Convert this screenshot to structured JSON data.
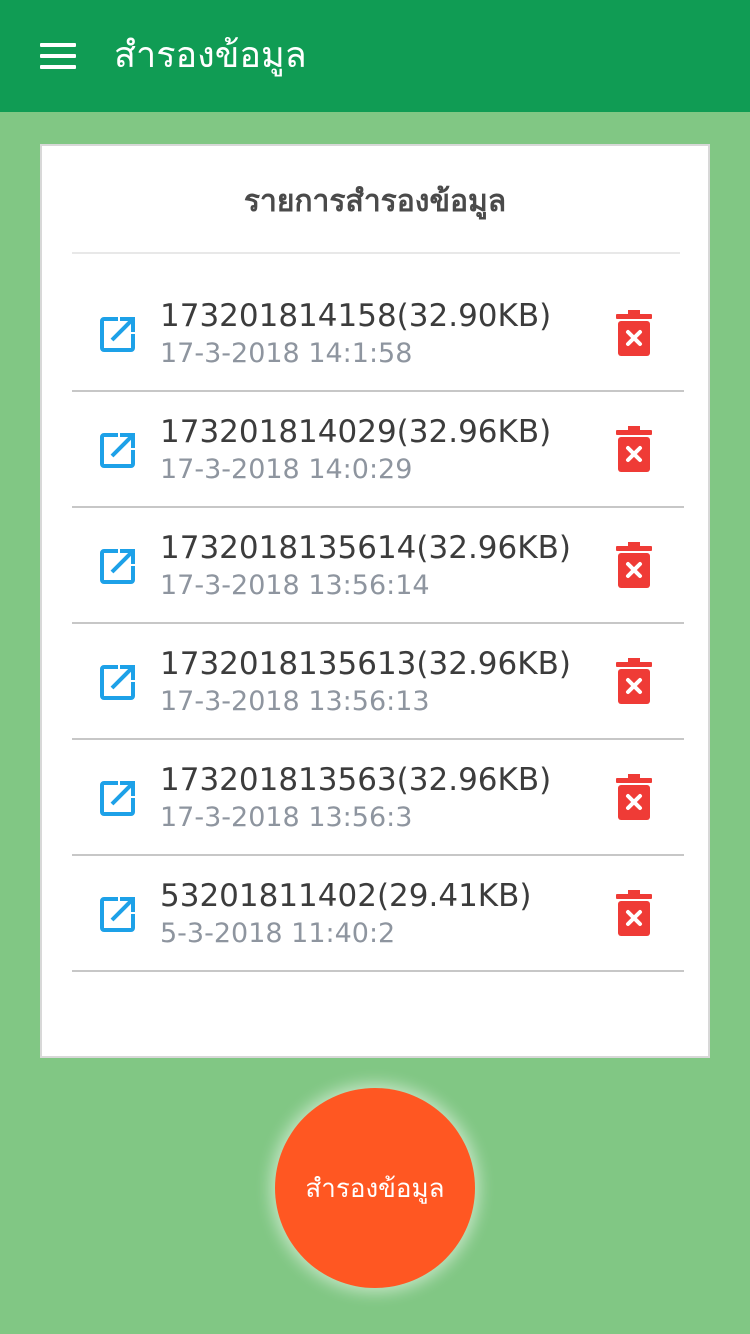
{
  "app_bar": {
    "title": "สำรองข้อมูล",
    "menu_icon": "menu-icon",
    "color": "#109c54"
  },
  "card": {
    "title": "รายการสำรองข้อมูล"
  },
  "backups": [
    {
      "name": "173201814158(32.90KB)",
      "date": "17-3-2018 14:1:58"
    },
    {
      "name": "173201814029(32.96KB)",
      "date": "17-3-2018 14:0:29"
    },
    {
      "name": "1732018135614(32.96KB)",
      "date": "17-3-2018 13:56:14"
    },
    {
      "name": "1732018135613(32.96KB)",
      "date": "17-3-2018 13:56:13"
    },
    {
      "name": "173201813563(32.96KB)",
      "date": "17-3-2018 13:56:3"
    },
    {
      "name": "53201811402(29.41KB)",
      "date": "5-3-2018 11:40:2"
    }
  ],
  "row_icons": {
    "open": "open-external-icon",
    "delete": "trash-delete-icon"
  },
  "fab": {
    "label": "สำรองข้อมูล",
    "color": "#ff5722"
  },
  "colors": {
    "background": "#81c784",
    "edit_icon": "#1da1e8",
    "delete_icon": "#ef3b36"
  }
}
